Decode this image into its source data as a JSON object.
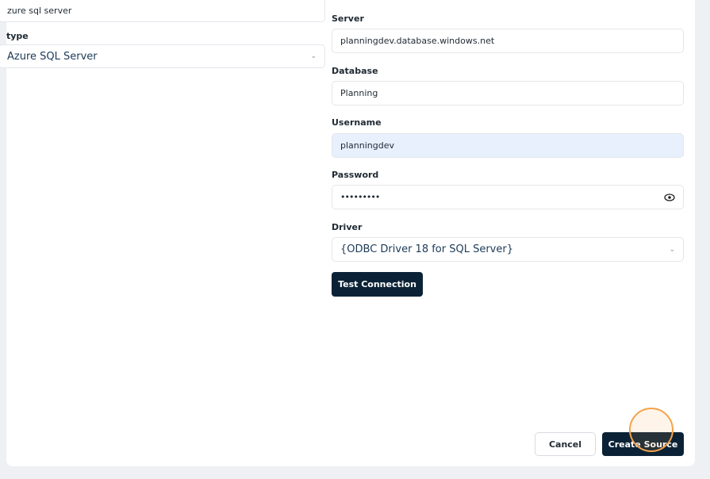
{
  "left": {
    "name_value": "zure sql server",
    "type_label": "type",
    "type_selected": "Azure SQL Server"
  },
  "form": {
    "server_label": "Server",
    "server_value": "planningdev.database.windows.net",
    "database_label": "Database",
    "database_value": "Planning",
    "username_label": "Username",
    "username_value": "planningdev",
    "password_label": "Password",
    "password_value": "•••••••••",
    "driver_label": "Driver",
    "driver_selected": "{ODBC Driver 18 for SQL Server}",
    "test_connection_label": "Test Connection"
  },
  "footer": {
    "cancel_label": "Cancel",
    "create_label": "Create Source"
  },
  "colors": {
    "primary": "#0b2236",
    "highlight_field": "#e8f0fe",
    "cursor_ring": "#f4a24a"
  },
  "icons": [
    "chevron-down-icon",
    "eye-icon"
  ]
}
